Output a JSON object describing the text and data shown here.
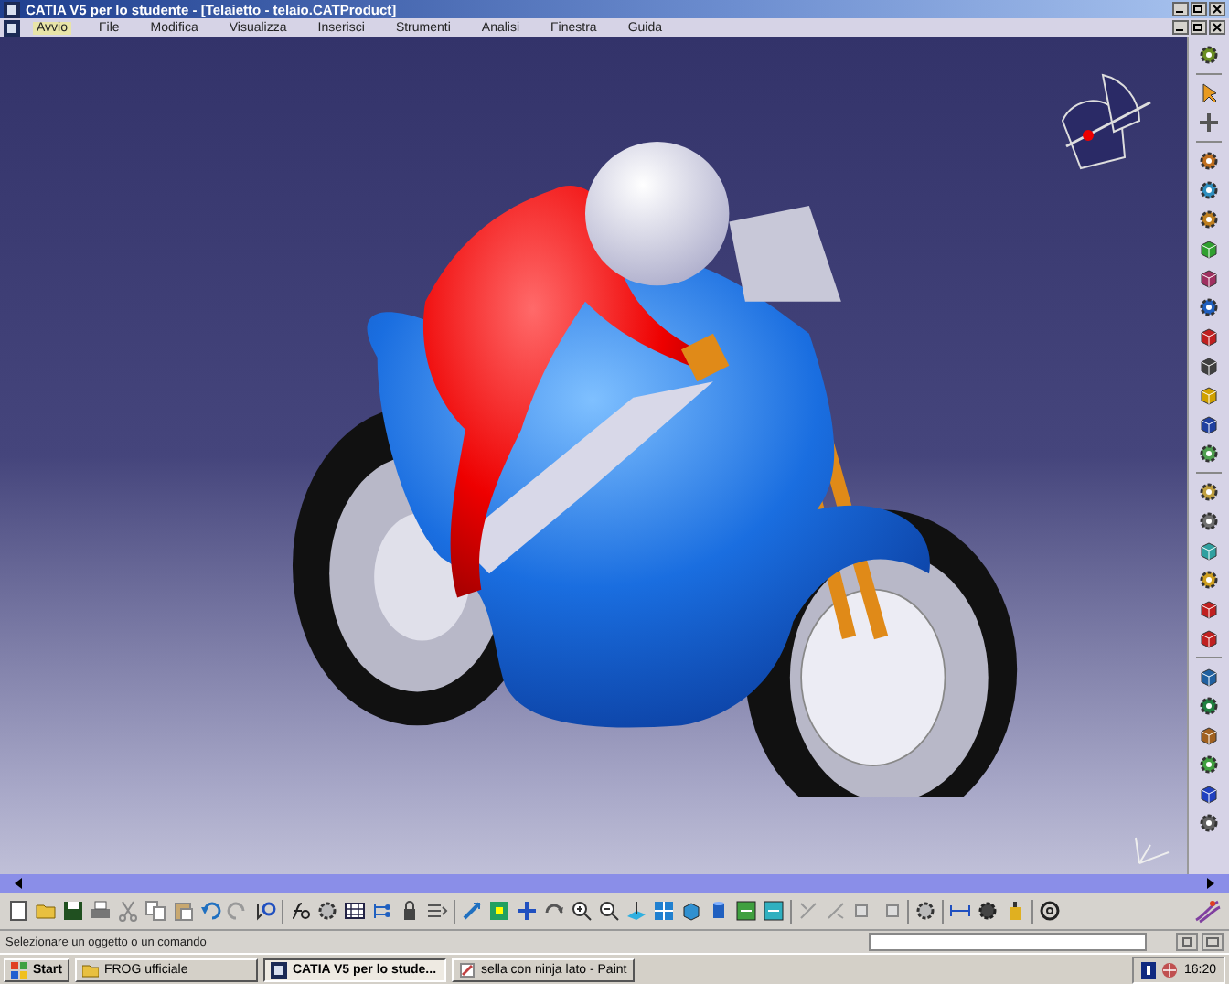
{
  "window": {
    "title": "CATIA V5 per lo studente - [Telaietto - telaio.CATProduct]"
  },
  "menu": [
    {
      "label": "Avvio",
      "selected": true
    },
    {
      "label": "File",
      "selected": false
    },
    {
      "label": "Modifica",
      "selected": false
    },
    {
      "label": "Visualizza",
      "selected": false
    },
    {
      "label": "Inserisci",
      "selected": false
    },
    {
      "label": "Strumenti",
      "selected": false
    },
    {
      "label": "Analisi",
      "selected": false
    },
    {
      "label": "Finestra",
      "selected": false
    },
    {
      "label": "Guida",
      "selected": false
    }
  ],
  "status_bar": {
    "message": "Selezionare un oggetto o un comando"
  },
  "taskbar": {
    "start": "Start",
    "items": [
      {
        "label": "FROG ufficiale",
        "kind": "folder",
        "selected": false
      },
      {
        "label": "CATIA V5 per lo stude...",
        "kind": "catia",
        "selected": true
      },
      {
        "label": "sella con ninja lato - Paint",
        "kind": "paint",
        "selected": false
      }
    ],
    "clock": "16:20"
  }
}
